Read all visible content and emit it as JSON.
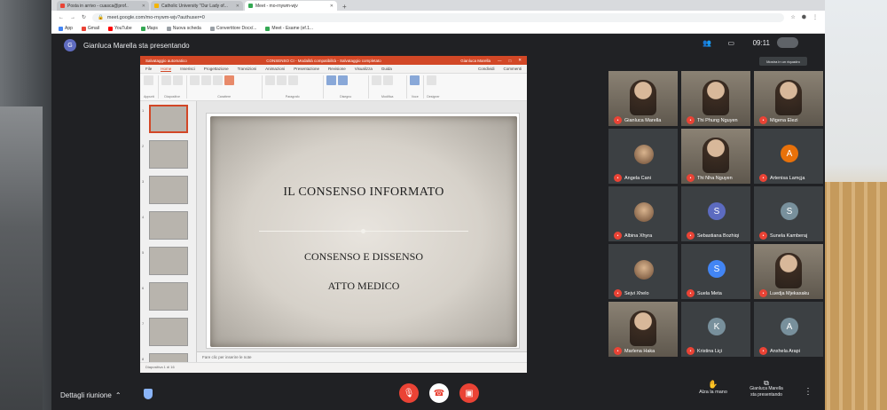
{
  "browser": {
    "tabs": [
      {
        "label": "Posta in arrivo - cuasca@prof..",
        "active": false,
        "color": "#ea4335"
      },
      {
        "label": "Catholic University \"Our Lady of...",
        "active": false,
        "color": "#f4b400"
      },
      {
        "label": "Meet - mo-rnywm-wjv",
        "active": true,
        "color": "#34a853"
      }
    ],
    "url": "meet.google.com/mo-rnywm-wjv?authuser=0",
    "bookmarks": [
      "App",
      "Gmail",
      "YouTube",
      "Maps",
      "Nuova scheda",
      "Convertitore Docx/...",
      "Meet - Esame (ef.1..."
    ]
  },
  "meet": {
    "presenter_initial": "G",
    "presenting_label": "Gianluca Marella sta presentando",
    "clock": "09:11",
    "tooltip": "Mostra in un riquadro"
  },
  "powerpoint": {
    "autosave": "Salvataggio automatico",
    "doc_title": "CONSENSO CI - Modalità compatibilità - Salvataggio completato",
    "user": "Gianluca Marella",
    "menu": [
      "File",
      "Home",
      "Inserisci",
      "Progettazione",
      "Transizioni",
      "Animazioni",
      "Presentazione",
      "Revisione",
      "Visualizza",
      "Guida"
    ],
    "share": "Condividi",
    "comments": "Commenti",
    "ribbon_groups": [
      "Appunti",
      "Diapositive",
      "Carattere",
      "Paragrafo",
      "Disegno",
      "Modifica",
      "Voce",
      "Designer"
    ],
    "slide": {
      "title": "IL CONSENSO INFORMATO",
      "sub1": "CONSENSO E DISSENSO",
      "sub2": "ATTO MEDICO"
    },
    "notes_placeholder": "Fare clic per inserire le note",
    "status": "Diapositiva 1 di 16",
    "thumb_count": 8
  },
  "participants": [
    {
      "name": "Gianluca Marella",
      "type": "video",
      "initial": ""
    },
    {
      "name": "Thi Phung Nguyen",
      "type": "video",
      "initial": ""
    },
    {
      "name": "Migena Elezi",
      "type": "video",
      "initial": ""
    },
    {
      "name": "Angela Cani",
      "type": "photo",
      "initial": ""
    },
    {
      "name": "Thi Nha Nguyen",
      "type": "video",
      "initial": ""
    },
    {
      "name": "Artenisa Lamçja",
      "type": "letter",
      "initial": "A",
      "color": "#e8710a"
    },
    {
      "name": "Albina Xhyra",
      "type": "photo",
      "initial": ""
    },
    {
      "name": "Sebastiana Bozhiqi",
      "type": "letter",
      "initial": "S",
      "color": "#5c6bc0"
    },
    {
      "name": "Sunela Kamberaj",
      "type": "letter",
      "initial": "S",
      "color": "#78909c"
    },
    {
      "name": "Sejvi Xhelo",
      "type": "photo",
      "initial": ""
    },
    {
      "name": "Suela Meta",
      "type": "letter",
      "initial": "S",
      "color": "#4285f4"
    },
    {
      "name": "Luedja Mjekaxaku",
      "type": "video",
      "initial": ""
    },
    {
      "name": "Marlena Haka",
      "type": "video",
      "initial": ""
    },
    {
      "name": "Kristina Liçi",
      "type": "letter",
      "initial": "K",
      "color": "#78909c"
    },
    {
      "name": "Anxhela Arapi",
      "type": "letter",
      "initial": "A",
      "color": "#78909c"
    }
  ],
  "bottom": {
    "meeting_details": "Dettagli riunione",
    "raise_hand": "Alza la mano",
    "presenting_line1": "Gianluca Marella",
    "presenting_line2": "sta presentando"
  },
  "colors": {
    "accent_red": "#ea4335",
    "ppt_orange": "#d24726",
    "meet_dark": "#202124"
  }
}
